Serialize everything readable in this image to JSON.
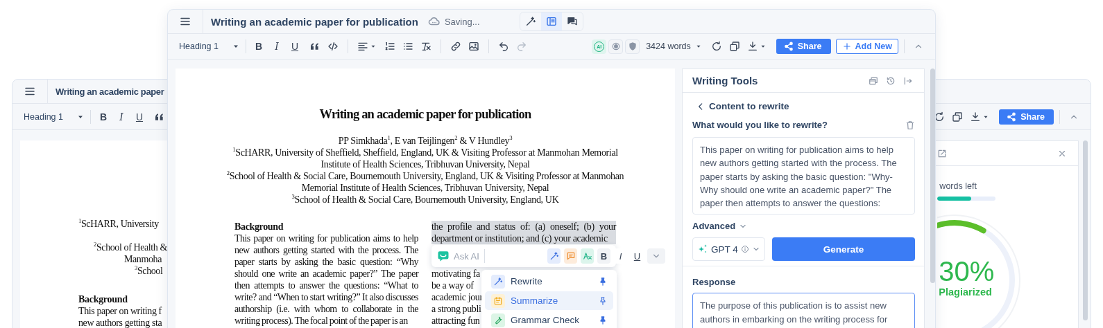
{
  "back_window": {
    "title": "Writing an academic paper",
    "toolbar": {
      "style": "Heading 1",
      "marks": [
        {
          "kind": "bold",
          "label": "B"
        },
        {
          "kind": "italic",
          "label": "I"
        },
        {
          "kind": "underline",
          "label": "U"
        }
      ],
      "share": "Share"
    },
    "document": {
      "affiliations": [
        "$^{1}$ScHARR, University",
        "$^{2}$School of Health &",
        "Manmoha",
        "$^{3}$School"
      ],
      "heading": "Background",
      "lines": [
        "This paper on writing f",
        "new authors getting sta"
      ]
    },
    "side_panel": {
      "words_left": "words left",
      "level": 0.58,
      "score": "30%",
      "score_label": "Plagiarized"
    }
  },
  "window": {
    "title": "Writing an academic paper for publication",
    "save_status": "Saving...",
    "views": [
      {
        "kind": "ai",
        "selected": false
      },
      {
        "kind": "layout",
        "selected": true
      },
      {
        "kind": "comments",
        "selected": false
      }
    ],
    "toolbar": {
      "style": "Heading 1",
      "marks": [
        {
          "kind": "bold",
          "label": "B"
        },
        {
          "kind": "italic",
          "label": "I"
        },
        {
          "kind": "underline",
          "label": "U"
        }
      ],
      "ai_badge": "AI",
      "word_count": "3424 words",
      "share": "Share",
      "add_new": "Add New"
    }
  },
  "document": {
    "title": "Writing an academic paper for publication",
    "authors": "PP Simkhada$^{1}$, E van Teijlingen$^{2}$ & V Hundley$^{3}$",
    "affiliations": [
      "$^{1}$ScHARR, University of Sheffield, Sheffield, England, UK & Visiting Professor at Manmohan Memorial Institute of Health Sciences, Tribhuvan University, Nepal",
      "$^{2}$School of Health & Social Care, Bournemouth University, England, UK & Visiting Professor at Manmohan Memorial Institute of Health Sciences, Tribhuvan University, Nepal",
      "$^{3}$School of Health & Social Care, Bournemouth University, England, UK"
    ],
    "left_column": {
      "heading": "Background",
      "text": "This paper on writing for publication aims to help new authors getting started with the process.  The paper starts by asking the basic question: “Why should one write an academic paper?”  The paper then attempts to answer the questions: “What to write? and “When to start writing?”  It also discusses authorship (i.e. with whom to collaborate in the writing process).  The focal point of the paper is an"
    },
    "right_column": {
      "highlighted": "the profile and status of: (a) oneself; (b) your department or institution; and (c) your academic",
      "lines": [
        "motivating fa",
        "be a way of",
        "academic jour",
        "a strong publi",
        "attracting fun"
      ]
    }
  },
  "ai_toolbar": {
    "placeholder": "Ask AI",
    "marks": [
      {
        "kind": "bold",
        "label": "B"
      },
      {
        "kind": "italic",
        "label": "I"
      },
      {
        "kind": "underline",
        "label": "U"
      }
    ]
  },
  "ai_menu": [
    {
      "kind": "rewrite",
      "label": "Rewrite",
      "selected": false,
      "pinned": true
    },
    {
      "kind": "summarize",
      "label": "Summarize",
      "selected": true,
      "pinned": false
    },
    {
      "kind": "grammar",
      "label": "Grammar Check",
      "selected": false,
      "pinned": true
    }
  ],
  "writing_tools": {
    "title": "Writing Tools",
    "back": "Content to rewrite",
    "prompt": "What would you like to rewrite?",
    "input": "This paper on writing for publication aims to help new authors getting started with the process. The paper starts by asking the basic question: \"Why-Why should one write an academic paper?\" The paper then attempts to answer the questions:",
    "advanced": "Advanced",
    "model": "GPT 4",
    "generate": "Generate",
    "response_label": "Response",
    "response": "The purpose of this publication is to assist new authors in embarking on the writing process for"
  }
}
